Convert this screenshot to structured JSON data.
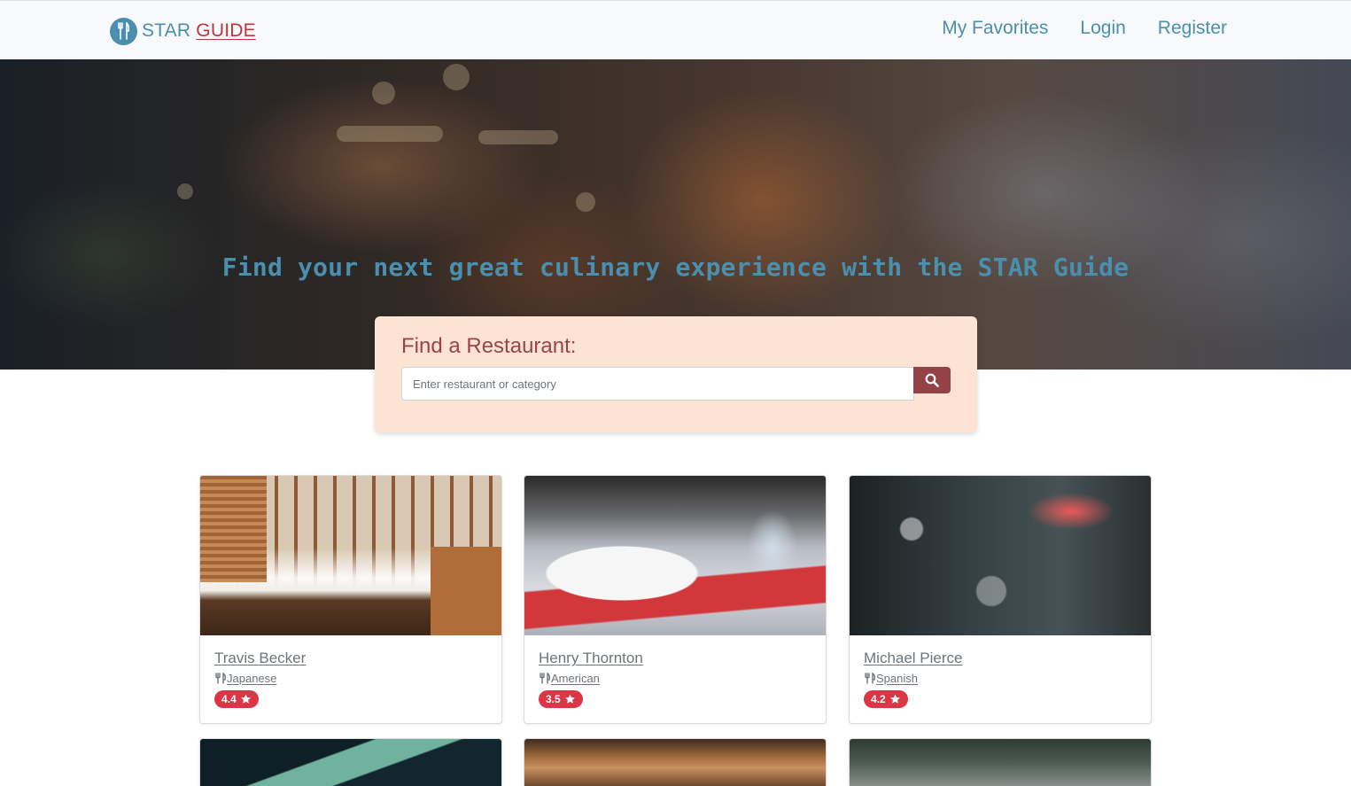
{
  "navbar": {
    "brand_part1": "STAR",
    "brand_part2": "GUIDE",
    "links": [
      "My Favorites",
      "Login",
      "Register"
    ]
  },
  "hero": {
    "title": "Find your next great culinary experience with the STAR Guide"
  },
  "search": {
    "heading": "Find a Restaurant:",
    "placeholder": "Enter restaurant or category"
  },
  "restaurants": [
    {
      "name": "Travis Becker",
      "category": "Japanese",
      "rating": "4.4"
    },
    {
      "name": "Henry Thornton",
      "category": "American",
      "rating": "3.5"
    },
    {
      "name": "Michael Pierce",
      "category": "Spanish",
      "rating": "4.2"
    }
  ],
  "colors": {
    "accent": "#4a8fae",
    "brand_red": "#c0343e",
    "search_panel_bg": "#fde3d4",
    "search_button": "#944246",
    "rating_badge": "#dc3545"
  },
  "icons": {
    "brand": "utensils-circle-icon",
    "search": "search-icon",
    "category": "utensils-icon",
    "rating": "star-icon"
  }
}
